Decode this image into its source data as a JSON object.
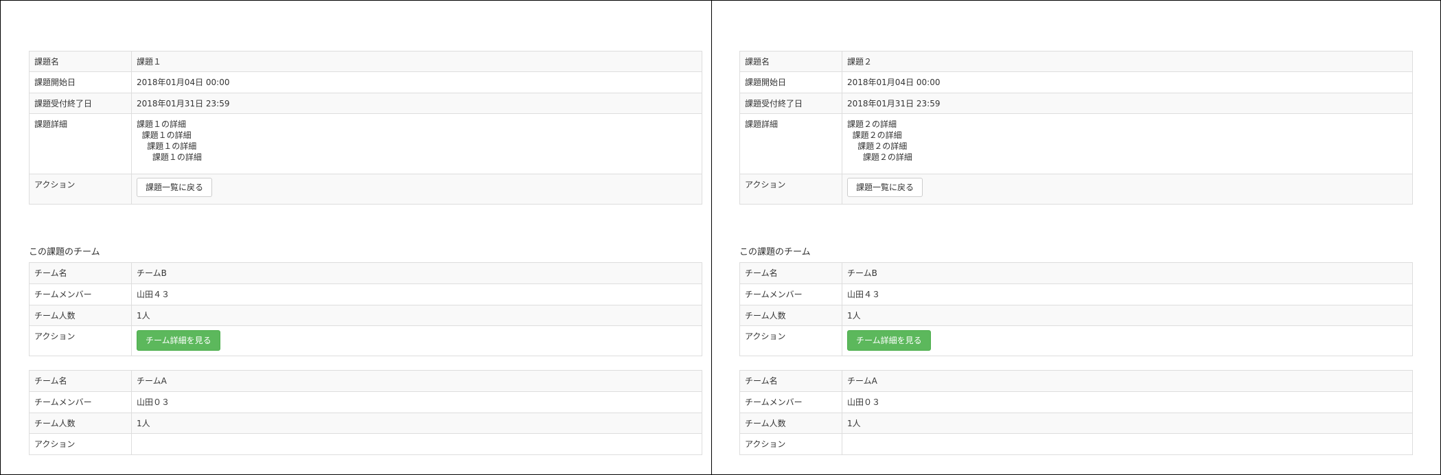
{
  "labels": {
    "task_name": "課題名",
    "start_date": "課題開始日",
    "end_date": "課題受付終了日",
    "detail": "課題詳細",
    "action": "アクション",
    "team_section_title": "この課題のチーム",
    "team_name": "チーム名",
    "team_members": "チームメンバー",
    "team_count": "チーム人数",
    "back_button": "課題一覧に戻る",
    "team_detail_button": "チーム詳細を見る"
  },
  "panels": [
    {
      "task": {
        "name": "課題１",
        "start": "2018年01月04日 00:00",
        "end": "2018年01月31日 23:59",
        "detail_lines": [
          "課題１の詳細",
          "  課題１の詳細",
          "    課題１の詳細",
          "      課題１の詳細"
        ]
      },
      "teams": [
        {
          "name": "チームB",
          "members": "山田４３",
          "count": "1人",
          "has_detail_button": true
        },
        {
          "name": "チームA",
          "members": "山田０３",
          "count": "1人",
          "has_detail_button": false
        }
      ]
    },
    {
      "task": {
        "name": "課題２",
        "start": "2018年01月04日 00:00",
        "end": "2018年01月31日 23:59",
        "detail_lines": [
          "課題２の詳細",
          "  課題２の詳細",
          "    課題２の詳細",
          "      課題２の詳細"
        ]
      },
      "teams": [
        {
          "name": "チームB",
          "members": "山田４３",
          "count": "1人",
          "has_detail_button": true
        },
        {
          "name": "チームA",
          "members": "山田０３",
          "count": "1人",
          "has_detail_button": false
        }
      ]
    }
  ]
}
